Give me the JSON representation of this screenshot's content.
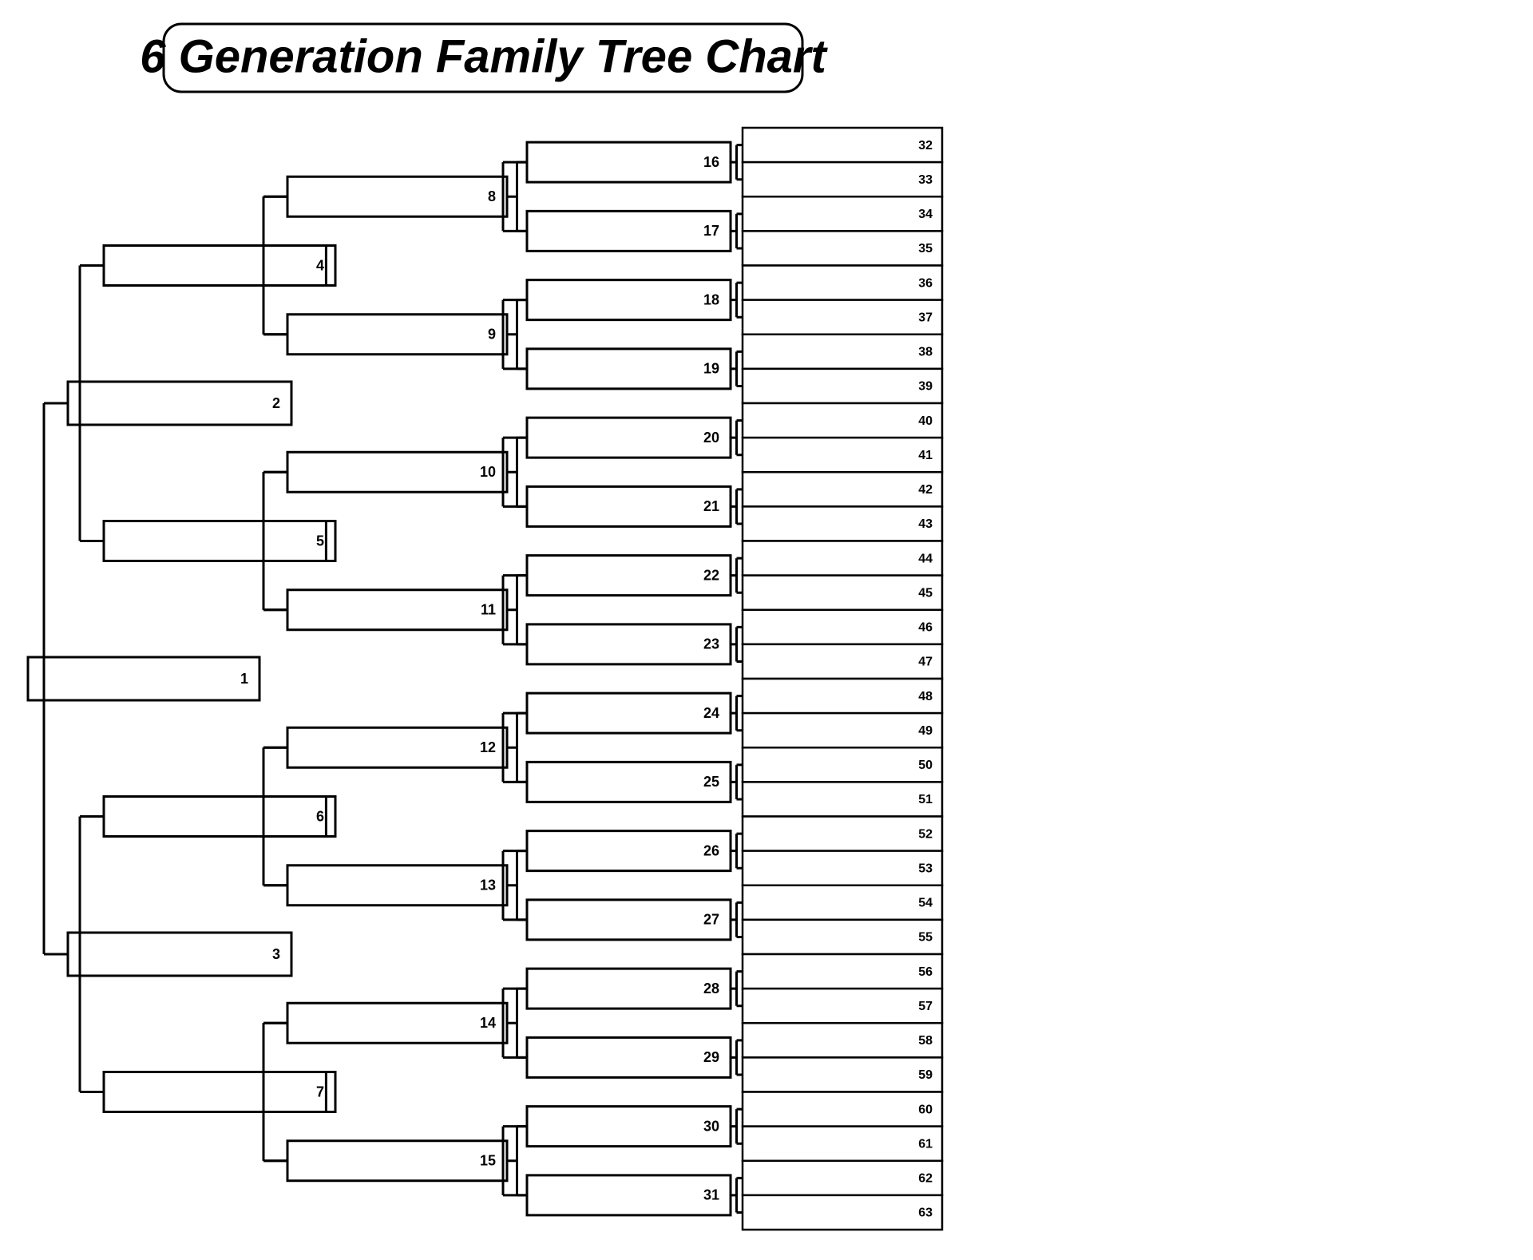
{
  "title": "6 Generation Family Tree Chart",
  "generations": [
    {
      "id": 1,
      "range_start": 1,
      "range_end": 1
    },
    {
      "id": 2,
      "range_start": 2,
      "range_end": 3
    },
    {
      "id": 3,
      "range_start": 4,
      "range_end": 7
    },
    {
      "id": 4,
      "range_start": 8,
      "range_end": 15
    },
    {
      "id": 5,
      "range_start": 16,
      "range_end": 31
    },
    {
      "id": 6,
      "range_start": 32,
      "range_end": 63
    }
  ],
  "nodes": {
    "1": "1",
    "2": "2",
    "3": "3",
    "4": "4",
    "5": "5",
    "6": "6",
    "7": "7",
    "8": "8",
    "9": "9",
    "10": "10",
    "11": "11",
    "12": "12",
    "13": "13",
    "14": "14",
    "15": "15",
    "16": "16",
    "17": "17",
    "18": "18",
    "19": "19",
    "20": "20",
    "21": "21",
    "22": "22",
    "23": "23",
    "24": "24",
    "25": "25",
    "26": "26",
    "27": "27",
    "28": "28",
    "29": "29",
    "30": "30",
    "31": "31",
    "32": "32",
    "33": "33",
    "34": "34",
    "35": "35",
    "36": "36",
    "37": "37",
    "38": "38",
    "39": "39",
    "40": "40",
    "41": "41",
    "42": "42",
    "43": "43",
    "44": "44",
    "45": "45",
    "46": "46",
    "47": "47",
    "48": "48",
    "49": "49",
    "50": "50",
    "51": "51",
    "52": "52",
    "53": "53",
    "54": "54",
    "55": "55",
    "56": "56",
    "57": "57",
    "58": "58",
    "59": "59",
    "60": "60",
    "61": "61",
    "62": "62",
    "63": "63"
  }
}
